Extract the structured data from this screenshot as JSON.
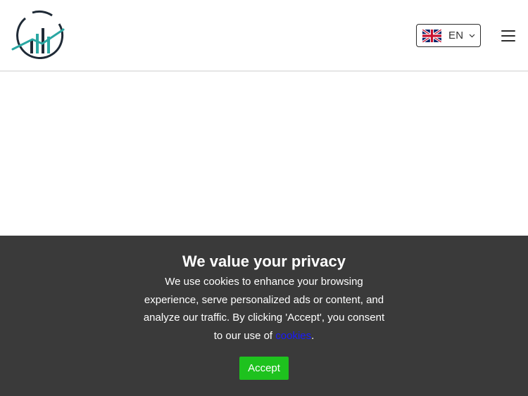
{
  "header": {
    "logo_icon": "chart-logo-icon",
    "language": {
      "code": "EN",
      "flag_icon": "uk-flag-icon",
      "chevron_icon": "chevron-down-icon"
    },
    "menu_icon": "hamburger-menu-icon"
  },
  "cookie_banner": {
    "title": "We value your privacy",
    "text_before_link": "We use cookies to enhance your browsing experience, serve personalized ads or content, and analyze our traffic. By clicking 'Accept', you consent to our use of ",
    "link_text": "cookies",
    "text_after_link": ".",
    "accept_label": "Accept"
  },
  "colors": {
    "banner_bg": "#3a3a3a",
    "accept_bg": "#1ec21e",
    "link": "#1a1aff",
    "logo_teal": "#2aa7a3",
    "logo_dark": "#1f2a36"
  }
}
